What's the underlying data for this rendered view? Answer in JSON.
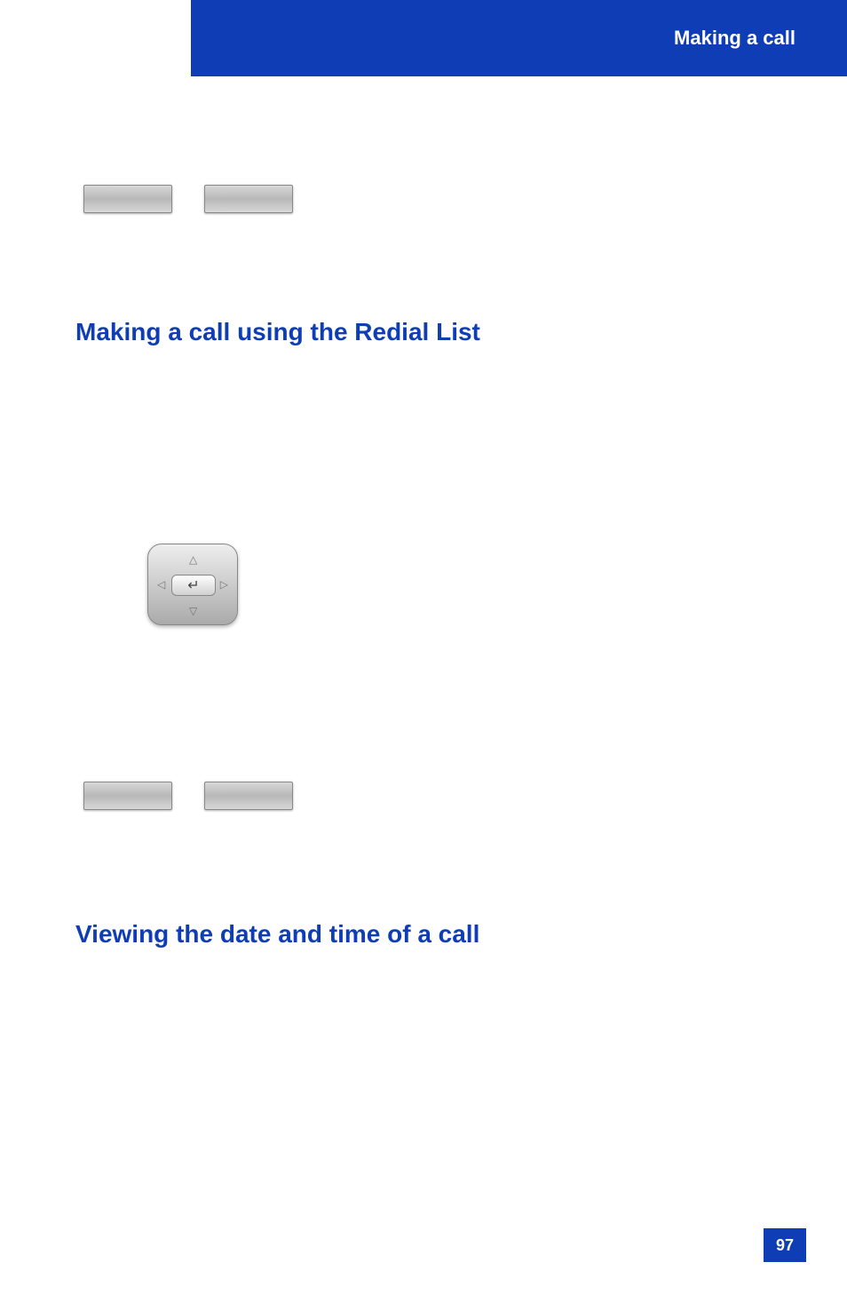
{
  "header": {
    "title": "Making a call"
  },
  "headings": {
    "redial": "Making a call using the Redial List",
    "viewing": "Viewing the date and time of a call"
  },
  "page_number": "97"
}
